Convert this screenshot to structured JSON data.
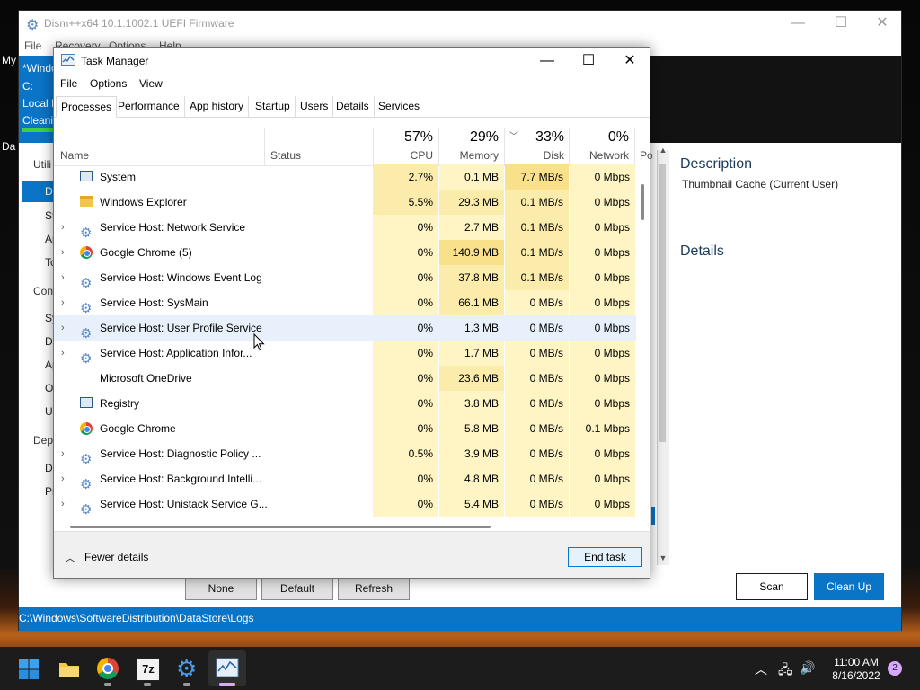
{
  "desktop": {
    "label_my": "My",
    "label_da": "Da"
  },
  "dism": {
    "title": "Dism++x64 10.1.1002.1 UEFI Firmware",
    "menu": [
      "File",
      "Recovery",
      "Options",
      "Help"
    ],
    "session": {
      "name": "*Windo",
      "drive": "C:",
      "disk": "Local D",
      "status": "Cleanin"
    },
    "sidebar": {
      "utilities_header": "Utili",
      "items_a": [
        "Dr",
        "St",
        "Ap",
        "To"
      ],
      "control_header": "Cont",
      "items_b": [
        "Sy",
        "Dr",
        "Ap",
        "Op",
        "Up"
      ],
      "deploy_header": "Depl",
      "items_c": [
        "De",
        "Pr"
      ]
    },
    "description_title": "Description",
    "description_text": "Thumbnail Cache (Current User)",
    "details_title": "Details",
    "buttons": {
      "none": "None",
      "default": "Default",
      "refresh": "Refresh",
      "scan": "Scan",
      "cleanup": "Clean Up"
    },
    "status_path": "C:\\Windows\\SoftwareDistribution\\DataStore\\Logs"
  },
  "taskmanager": {
    "title": "Task Manager",
    "menu": [
      "File",
      "Options",
      "View"
    ],
    "tabs": [
      "Processes",
      "Performance",
      "App history",
      "Startup",
      "Users",
      "Details",
      "Services"
    ],
    "active_tab": "Processes",
    "columns": {
      "name": "Name",
      "status": "Status",
      "cpu": {
        "pct": "57%",
        "label": "CPU"
      },
      "memory": {
        "pct": "29%",
        "label": "Memory"
      },
      "disk": {
        "pct": "33%",
        "label": "Disk"
      },
      "network": {
        "pct": "0%",
        "label": "Network"
      },
      "power": "Po"
    },
    "rows": [
      {
        "name": "System",
        "icon": "system-icon",
        "expandable": false,
        "cpu": "2.7%",
        "mem": "0.1 MB",
        "disk": "7.7 MB/s",
        "net": "0 Mbps"
      },
      {
        "name": "Windows Explorer",
        "icon": "folder-icon",
        "expandable": false,
        "cpu": "5.5%",
        "mem": "29.3 MB",
        "disk": "0.1 MB/s",
        "net": "0 Mbps"
      },
      {
        "name": "Service Host: Network Service",
        "icon": "gear-icon",
        "expandable": true,
        "cpu": "0%",
        "mem": "2.7 MB",
        "disk": "0.1 MB/s",
        "net": "0 Mbps"
      },
      {
        "name": "Google Chrome (5)",
        "icon": "chrome-icon",
        "expandable": true,
        "cpu": "0%",
        "mem": "140.9 MB",
        "disk": "0.1 MB/s",
        "net": "0 Mbps"
      },
      {
        "name": "Service Host: Windows Event Log",
        "icon": "gear-icon",
        "expandable": true,
        "cpu": "0%",
        "mem": "37.8 MB",
        "disk": "0.1 MB/s",
        "net": "0 Mbps"
      },
      {
        "name": "Service Host: SysMain",
        "icon": "gear-icon",
        "expandable": true,
        "cpu": "0%",
        "mem": "66.1 MB",
        "disk": "0 MB/s",
        "net": "0 Mbps"
      },
      {
        "name": "Service Host: User Profile Service",
        "icon": "gear-icon",
        "expandable": true,
        "cpu": "0%",
        "mem": "1.3 MB",
        "disk": "0 MB/s",
        "net": "0 Mbps"
      },
      {
        "name": "Service Host: Application Infor...",
        "icon": "gear-icon",
        "expandable": true,
        "cpu": "0%",
        "mem": "1.7 MB",
        "disk": "0 MB/s",
        "net": "0 Mbps"
      },
      {
        "name": "Microsoft OneDrive",
        "icon": "",
        "expandable": false,
        "cpu": "0%",
        "mem": "23.6 MB",
        "disk": "0 MB/s",
        "net": "0 Mbps"
      },
      {
        "name": "Registry",
        "icon": "system-icon",
        "expandable": false,
        "cpu": "0%",
        "mem": "3.8 MB",
        "disk": "0 MB/s",
        "net": "0 Mbps"
      },
      {
        "name": "Google Chrome",
        "icon": "chrome-icon",
        "expandable": false,
        "cpu": "0%",
        "mem": "5.8 MB",
        "disk": "0 MB/s",
        "net": "0.1 Mbps"
      },
      {
        "name": "Service Host: Diagnostic Policy ...",
        "icon": "gear-icon",
        "expandable": true,
        "cpu": "0.5%",
        "mem": "3.9 MB",
        "disk": "0 MB/s",
        "net": "0 Mbps"
      },
      {
        "name": "Service Host: Background Intelli...",
        "icon": "gear-icon",
        "expandable": true,
        "cpu": "0%",
        "mem": "4.8 MB",
        "disk": "0 MB/s",
        "net": "0 Mbps"
      },
      {
        "name": "Service Host: Unistack Service G...",
        "icon": "gear-icon",
        "expandable": true,
        "cpu": "0%",
        "mem": "5.4 MB",
        "disk": "0 MB/s",
        "net": "0 Mbps"
      }
    ],
    "hovered_row": 6,
    "fewer_details": "Fewer details",
    "end_task": "End task"
  },
  "taskbar": {
    "apps": [
      "start-icon",
      "file-explorer-icon",
      "chrome-icon",
      "7zip-icon",
      "dism-icon",
      "task-manager-icon"
    ],
    "zip_label": "7z",
    "time": "11:00 AM",
    "date": "8/16/2022",
    "notifications": "2"
  },
  "colors": {
    "accent": "#0a74c7",
    "heat_light": "#fff4c4",
    "heat_mid": "#fcecab",
    "heat_strong": "#f9e08a",
    "hover": "#e8f1fb"
  }
}
